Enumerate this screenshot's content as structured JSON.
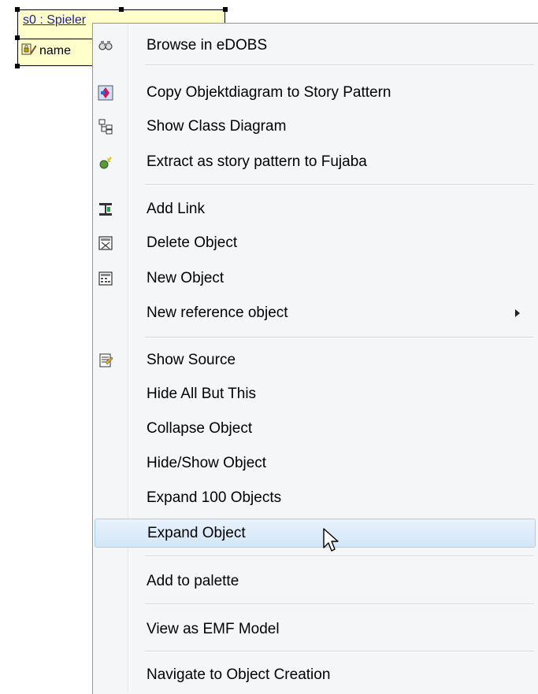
{
  "diagram_object": {
    "title": "s0 : Spieler",
    "attribute": "name"
  },
  "menu": {
    "items": [
      {
        "label": "Browse in eDOBS",
        "icon": "binoculars-icon"
      },
      {
        "label": "Copy Objektdiagram to Story Pattern",
        "icon": "copy-pattern-icon"
      },
      {
        "label": "Show Class Diagram",
        "icon": "class-diagram-icon"
      },
      {
        "label": "Extract as story pattern to Fujaba",
        "icon": "extract-pattern-icon"
      },
      {
        "label": "Add Link",
        "icon": "link-icon"
      },
      {
        "label": "Delete Object",
        "icon": "delete-object-icon"
      },
      {
        "label": "New Object",
        "icon": "new-object-icon"
      },
      {
        "label": "New reference object",
        "icon": ""
      },
      {
        "label": "Show Source",
        "icon": "source-icon"
      },
      {
        "label": "Hide All But This",
        "icon": ""
      },
      {
        "label": "Collapse Object",
        "icon": ""
      },
      {
        "label": "Hide/Show Object",
        "icon": ""
      },
      {
        "label": "Expand 100 Objects",
        "icon": ""
      },
      {
        "label": "Expand Object",
        "icon": ""
      },
      {
        "label": "Add to palette",
        "icon": ""
      },
      {
        "label": "View as EMF Model",
        "icon": ""
      },
      {
        "label": "Navigate to Object Creation",
        "icon": ""
      }
    ],
    "highlighted_item": "Expand Object",
    "highlight_color": "#d3e6f8"
  }
}
